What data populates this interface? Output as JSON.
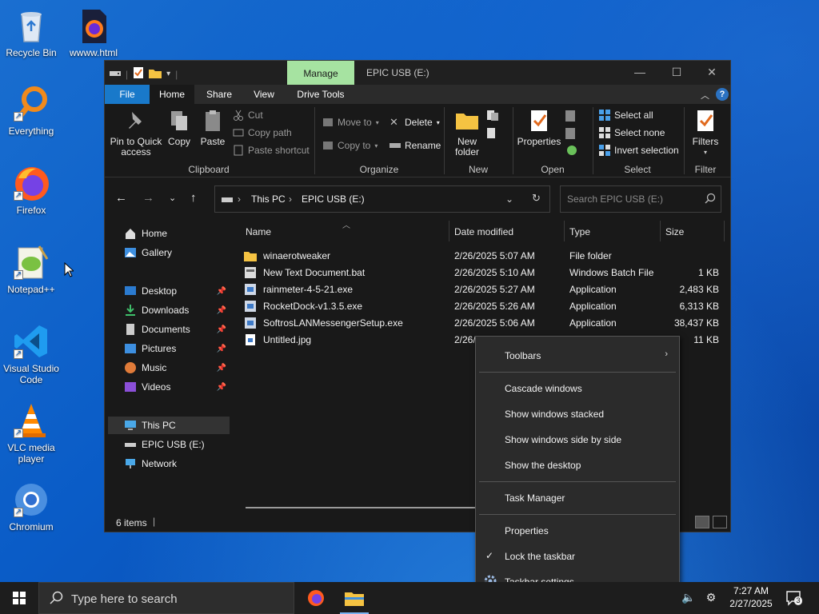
{
  "desktop": {
    "icons": [
      {
        "label": "Recycle Bin"
      },
      {
        "label": "wwww.html"
      },
      {
        "label": "Everything"
      },
      {
        "label": "Firefox"
      },
      {
        "label": "Notepad++"
      },
      {
        "label": "Visual Studio Code"
      },
      {
        "label": "VLC media player"
      },
      {
        "label": "Chromium"
      }
    ]
  },
  "window": {
    "title": "EPIC USB (E:)",
    "manage_tab": "Manage",
    "tabs": [
      "File",
      "Home",
      "Share",
      "View",
      "Drive Tools"
    ],
    "ribbon": {
      "clipboard": {
        "group_label": "Clipboard",
        "pin_label": "Pin to Quick access",
        "copy_label": "Copy",
        "paste_label": "Paste",
        "cut_label": "Cut",
        "copy_path_label": "Copy path",
        "paste_shortcut_label": "Paste shortcut"
      },
      "organize": {
        "group_label": "Organize",
        "move_to_label": "Move to",
        "copy_to_label": "Copy to",
        "delete_label": "Delete",
        "rename_label": "Rename"
      },
      "new": {
        "group_label": "New",
        "new_folder_label": "New folder"
      },
      "open": {
        "group_label": "Open",
        "properties_label": "Properties"
      },
      "select": {
        "group_label": "Select",
        "select_all_label": "Select all",
        "select_none_label": "Select none",
        "invert_label": "Invert selection"
      },
      "filter": {
        "group_label": "Filter",
        "filters_label": "Filters"
      }
    },
    "address": {
      "crumbs": [
        "This PC",
        "EPIC USB (E:)"
      ],
      "search_placeholder": "Search EPIC USB (E:)"
    },
    "nav": {
      "items": [
        {
          "label": "Home"
        },
        {
          "label": "Gallery"
        },
        {
          "label": "Desktop"
        },
        {
          "label": "Downloads"
        },
        {
          "label": "Documents"
        },
        {
          "label": "Pictures"
        },
        {
          "label": "Music"
        },
        {
          "label": "Videos"
        },
        {
          "label": "This PC"
        },
        {
          "label": "EPIC USB (E:)"
        },
        {
          "label": "Network"
        }
      ]
    },
    "columns": {
      "name": "Name",
      "date": "Date modified",
      "type": "Type",
      "size": "Size"
    },
    "files": [
      {
        "name": "winaerotweaker",
        "date": "2/26/2025 5:07 AM",
        "type": "File folder",
        "size": ""
      },
      {
        "name": "New Text Document.bat",
        "date": "2/26/2025 5:10 AM",
        "type": "Windows Batch File",
        "size": "1 KB"
      },
      {
        "name": "rainmeter-4-5-21.exe",
        "date": "2/26/2025 5:27 AM",
        "type": "Application",
        "size": "2,483 KB"
      },
      {
        "name": "RocketDock-v1.3.5.exe",
        "date": "2/26/2025 5:26 AM",
        "type": "Application",
        "size": "6,313 KB"
      },
      {
        "name": "SoftrosLANMessengerSetup.exe",
        "date": "2/26/2025 5:06 AM",
        "type": "Application",
        "size": "38,437 KB"
      },
      {
        "name": "Untitled.jpg",
        "date": "2/26/",
        "type": "",
        "size": "11 KB"
      }
    ],
    "status": "6 items"
  },
  "context_menu": {
    "toolbars": "Toolbars",
    "cascade": "Cascade windows",
    "stacked": "Show windows stacked",
    "side_by_side": "Show windows side by side",
    "show_desktop": "Show the desktop",
    "task_manager": "Task Manager",
    "properties": "Properties",
    "lock": "Lock the taskbar",
    "settings": "Taskbar settings"
  },
  "taskbar": {
    "search_placeholder": "Type here to search",
    "time": "7:27 AM",
    "date": "2/27/2025",
    "notification_count": "3"
  },
  "colors": {
    "accent": "#1979ca",
    "manage": "#a6e3a1",
    "folder": "#f5c342"
  }
}
